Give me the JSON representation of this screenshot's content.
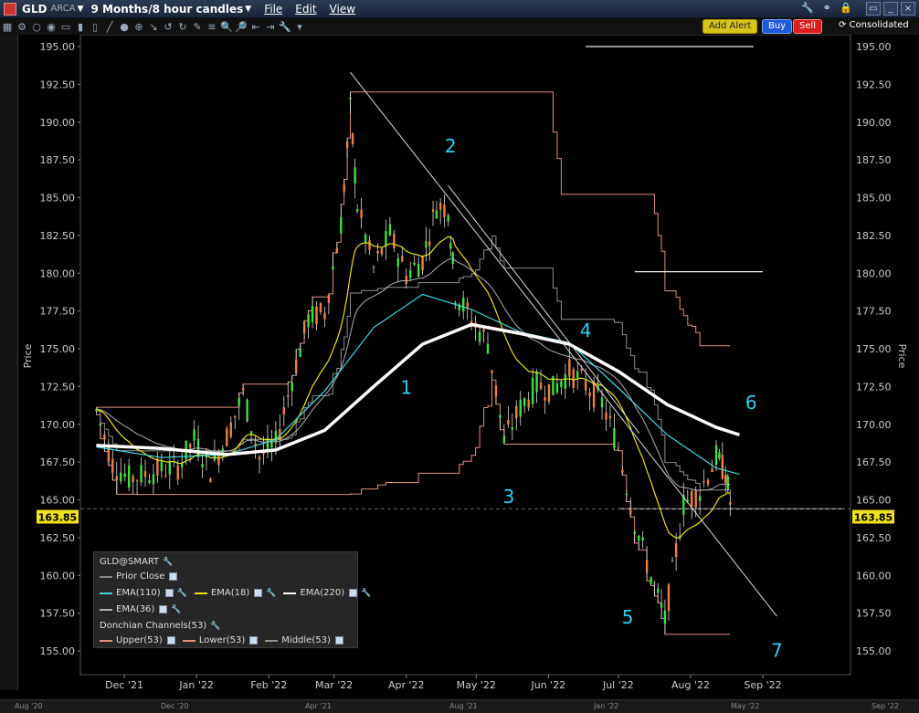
{
  "titlebar": {
    "symbol": "GLD",
    "exchange": "ARCA",
    "period": "9 Months/8 hour candles",
    "menus": [
      "File",
      "Edit",
      "View"
    ]
  },
  "toolbar": {
    "add_alert": "Add Alert",
    "buy": "Buy",
    "sell": "Sell",
    "consolidated": "Consolidated"
  },
  "colors": {
    "ema110": "#40d8e0",
    "ema18": "#e8e020",
    "ema220": "#ffffff",
    "ema36": "#b0b0b0",
    "donchian_upper": "#e09080",
    "donchian_lower": "#e09080",
    "donchian_middle": "#909090",
    "annotation": "#30d0f0",
    "price_tag": "#f0e020"
  },
  "legend": {
    "title": "GLD@SMART",
    "prior_close": "Prior Close",
    "ema110": "EMA(110)",
    "ema18": "EMA(18)",
    "ema220": "EMA(220)",
    "ema36": "EMA(36)",
    "donchian": "Donchian Channels(53)",
    "upper": "Upper(53)",
    "lower": "Lower(53)",
    "middle": "Middle(53)"
  },
  "axis": {
    "ylabel": "Price",
    "last_price": "163.85"
  },
  "bottom_nav": [
    "Aug '20",
    "Dec '20",
    "Apr '21",
    "Aug '21",
    "Jan '22",
    "May '22",
    "Sep '22"
  ],
  "chart_data": {
    "type": "candlestick",
    "title": "",
    "ylabel": "Price",
    "ylim": [
      154,
      196
    ],
    "y_ticks": [
      "195.00",
      "192.50",
      "190.00",
      "187.50",
      "185.00",
      "182.50",
      "180.00",
      "177.50",
      "175.00",
      "172.50",
      "170.00",
      "167.50",
      "165.00",
      "162.50",
      "160.00",
      "157.50",
      "155.00"
    ],
    "x_ticks": [
      "Dec '21",
      "Jan '22",
      "Feb '22",
      "Mar '22",
      "Apr '22",
      "May '22",
      "Jun '22",
      "Jul '22",
      "Aug '22",
      "Sep '22"
    ],
    "last_price": 163.85,
    "annotations": [
      {
        "label": "1",
        "date": "2022-04-01",
        "price": 172.0
      },
      {
        "label": "2",
        "date": "2022-04-20",
        "price": 188.0
      },
      {
        "label": "3",
        "date": "2022-05-15",
        "price": 164.8
      },
      {
        "label": "4",
        "date": "2022-06-17",
        "price": 175.8
      },
      {
        "label": "5",
        "date": "2022-07-05",
        "price": 156.8
      },
      {
        "label": "6",
        "date": "2022-08-27",
        "price": 171.0
      },
      {
        "label": "7",
        "date": "2022-09-07",
        "price": 154.6
      }
    ],
    "series": [
      {
        "name": "Close",
        "points": [
          [
            "2021-11-19",
            170.9
          ],
          [
            "2021-11-26",
            167.4
          ],
          [
            "2021-12-03",
            166.4
          ],
          [
            "2021-12-10",
            166.7
          ],
          [
            "2021-12-17",
            167.0
          ],
          [
            "2021-12-24",
            167.2
          ],
          [
            "2021-12-31",
            169.0
          ],
          [
            "2022-01-07",
            167.0
          ],
          [
            "2022-01-14",
            169.2
          ],
          [
            "2022-01-21",
            172.0
          ],
          [
            "2022-01-28",
            167.8
          ],
          [
            "2022-02-04",
            168.7
          ],
          [
            "2022-02-11",
            173.0
          ],
          [
            "2022-02-18",
            177.0
          ],
          [
            "2022-02-25",
            177.4
          ],
          [
            "2022-03-04",
            183.3
          ],
          [
            "2022-03-08",
            190.8
          ],
          [
            "2022-03-11",
            184.5
          ],
          [
            "2022-03-18",
            180.3
          ],
          [
            "2022-03-25",
            182.6
          ],
          [
            "2022-04-01",
            179.9
          ],
          [
            "2022-04-08",
            180.9
          ],
          [
            "2022-04-14",
            184.5
          ],
          [
            "2022-04-19",
            184.3
          ],
          [
            "2022-04-22",
            178.7
          ],
          [
            "2022-04-29",
            176.9
          ],
          [
            "2022-05-06",
            175.4
          ],
          [
            "2022-05-13",
            168.9
          ],
          [
            "2022-05-20",
            171.1
          ],
          [
            "2022-05-27",
            172.6
          ],
          [
            "2022-06-03",
            172.3
          ],
          [
            "2022-06-10",
            173.5
          ],
          [
            "2022-06-17",
            172.6
          ],
          [
            "2022-06-24",
            171.4
          ],
          [
            "2022-07-01",
            168.5
          ],
          [
            "2022-07-08",
            163.5
          ],
          [
            "2022-07-15",
            159.9
          ],
          [
            "2022-07-21",
            157.0
          ],
          [
            "2022-07-29",
            164.7
          ],
          [
            "2022-08-05",
            165.6
          ],
          [
            "2022-08-12",
            167.8
          ],
          [
            "2022-08-16",
            166.8
          ],
          [
            "2022-08-19",
            163.85
          ]
        ]
      },
      {
        "name": "EMA(220)",
        "points": [
          [
            "2021-11-19",
            168.6
          ],
          [
            "2021-12-17",
            168.4
          ],
          [
            "2022-01-14",
            168.0
          ],
          [
            "2022-02-04",
            168.3
          ],
          [
            "2022-02-25",
            169.6
          ],
          [
            "2022-03-18",
            172.5
          ],
          [
            "2022-04-08",
            175.3
          ],
          [
            "2022-04-29",
            176.6
          ],
          [
            "2022-05-20",
            176.0
          ],
          [
            "2022-06-10",
            175.3
          ],
          [
            "2022-07-01",
            173.5
          ],
          [
            "2022-07-22",
            171.3
          ],
          [
            "2022-08-12",
            169.8
          ],
          [
            "2022-08-22",
            169.3
          ]
        ]
      },
      {
        "name": "EMA(110)",
        "points": [
          [
            "2021-11-19",
            168.5
          ],
          [
            "2021-12-17",
            167.8
          ],
          [
            "2022-01-14",
            168.0
          ],
          [
            "2022-02-04",
            169.0
          ],
          [
            "2022-02-25",
            172.2
          ],
          [
            "2022-03-18",
            176.4
          ],
          [
            "2022-04-08",
            178.6
          ],
          [
            "2022-04-29",
            177.6
          ],
          [
            "2022-05-20",
            176.1
          ],
          [
            "2022-06-10",
            175.4
          ],
          [
            "2022-07-01",
            172.4
          ],
          [
            "2022-07-22",
            169.3
          ],
          [
            "2022-08-12",
            167.1
          ],
          [
            "2022-08-22",
            166.7
          ]
        ]
      }
    ]
  }
}
